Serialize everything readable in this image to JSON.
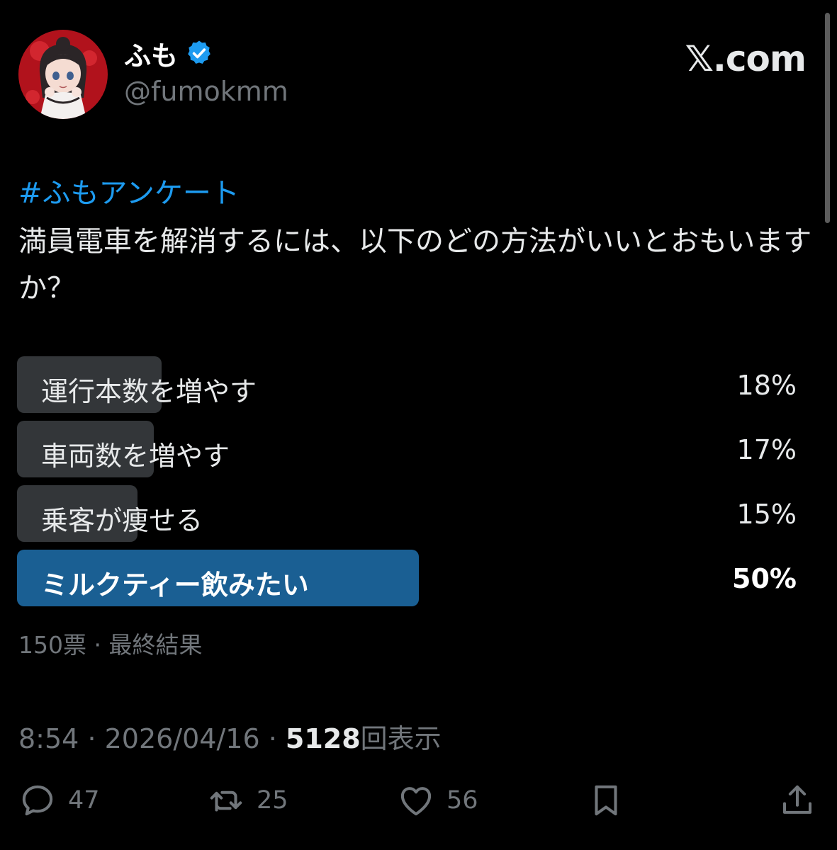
{
  "author": {
    "display_name": "ふも",
    "handle": "@fumokmm",
    "verified_icon": "verified-badge-icon",
    "verified_color": "#1d9bf0"
  },
  "brand": "𝕏.com",
  "tweet": {
    "hashtag": "#ふもアンケート",
    "question": "満員電車を解消するには、以下のどの方法がいいとおもいますか？"
  },
  "poll": {
    "options": [
      {
        "label": "運行本数を増やす",
        "percent": "18%",
        "fraction": 0.18
      },
      {
        "label": "車両数を増やす",
        "percent": "17%",
        "fraction": 0.17
      },
      {
        "label": "乗客が痩せる",
        "percent": "15%",
        "fraction": 0.15
      },
      {
        "label": "ミルクティー飲みたい",
        "percent": "50%",
        "fraction": 0.5,
        "winner": true
      }
    ],
    "bar_color": "#333639",
    "winner_color": "#1a5f93",
    "votes": "150票",
    "status": "最終結果"
  },
  "meta": {
    "time": "8:54",
    "date": "2026/04/16",
    "views": "5128",
    "views_label": "回表示"
  },
  "actions": {
    "replies": "47",
    "retweets": "25",
    "likes": "56"
  },
  "colors": {
    "background": "#000000",
    "text": "#e7e9ea",
    "muted": "#71767b",
    "link": "#1d9bf0"
  }
}
